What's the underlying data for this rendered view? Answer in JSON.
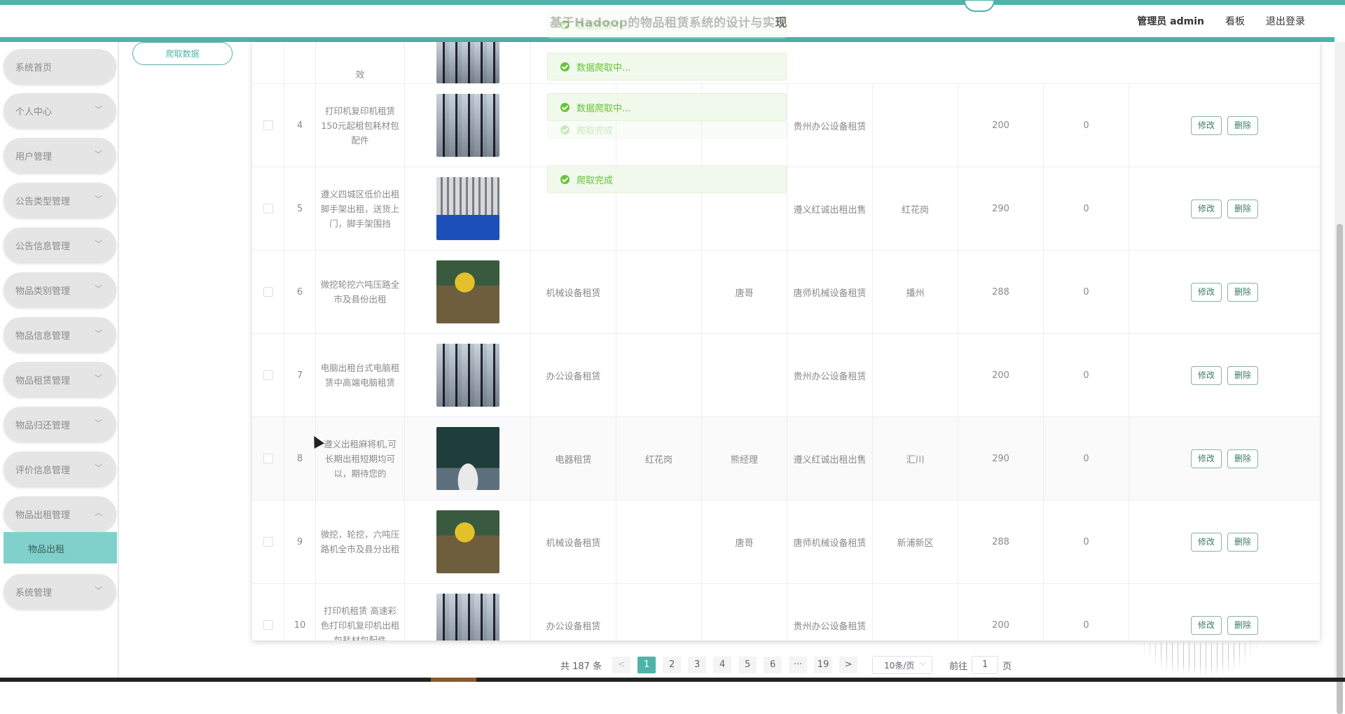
{
  "header": {
    "title_faded": "基于Hadoop的物品租赁系统的设计与实",
    "title_tail": "现",
    "user": "管理员 admin",
    "board": "看板",
    "logout": "退出登录"
  },
  "sidebar": {
    "items": [
      {
        "label": "系统首页",
        "chevron": ""
      },
      {
        "label": "个人中心",
        "chevron": "﹀"
      },
      {
        "label": "用户管理",
        "chevron": "﹀"
      },
      {
        "label": "公告类型管理",
        "chevron": "﹀"
      },
      {
        "label": "公告信息管理",
        "chevron": "﹀"
      },
      {
        "label": "物品类别管理",
        "chevron": "﹀"
      },
      {
        "label": "物品信息管理",
        "chevron": "﹀"
      },
      {
        "label": "物品租赁管理",
        "chevron": "﹀"
      },
      {
        "label": "物品归还管理",
        "chevron": "﹀"
      },
      {
        "label": "评价信息管理",
        "chevron": "﹀"
      },
      {
        "label": "物品出租管理",
        "chevron": "︿"
      }
    ],
    "submenu_label": "物品出租",
    "last_item": {
      "label": "系统管理",
      "chevron": "﹀"
    }
  },
  "crawl_button": "爬取数据",
  "top_row_partial_text": "效",
  "rows": [
    {
      "index": "4",
      "name": "打印机复印机租赁150元起租包耗材包配件",
      "image": "office-printer-image",
      "category": "",
      "area": "",
      "contact": "",
      "shop": "贵州办公设备租赁",
      "district": "",
      "price": "200",
      "count": "0"
    },
    {
      "index": "5",
      "name": "遵义四城区低价出租脚手架出租，送货上门，脚手架围挡",
      "image": "scaffold-image",
      "category": "",
      "area": "",
      "contact": "",
      "shop": "遵义红诚出租出售",
      "district": "红花岗",
      "price": "290",
      "count": "0"
    },
    {
      "index": "6",
      "name": "微挖轮挖六吨压路全市及县份出租",
      "image": "excavator-image",
      "category": "机械设备租赁",
      "area": "",
      "contact": "唐哥",
      "shop": "唐师机械设备租赁",
      "district": "播州",
      "price": "288",
      "count": "0"
    },
    {
      "index": "7",
      "name": "电脑出租台式电脑租赁中高端电脑租赁",
      "image": "office-printer-image",
      "category": "办公设备租赁",
      "area": "",
      "contact": "",
      "shop": "贵州办公设备租赁",
      "district": "",
      "price": "200",
      "count": "0"
    },
    {
      "index": "8",
      "name": "遵义出租麻将机,可长期出租短期均可以，期待您的",
      "image": "mahjong-table-image",
      "category": "电器租赁",
      "area": "红花岗",
      "contact": "熊经理",
      "shop": "遵义红诚出租出售",
      "district": "汇川",
      "price": "290",
      "count": "0"
    },
    {
      "index": "9",
      "name": "微挖，轮挖，六吨压路机全市及县分出租",
      "image": "excavator-image",
      "category": "机械设备租赁",
      "area": "",
      "contact": "唐哥",
      "shop": "唐师机械设备租赁",
      "district": "新浦新区",
      "price": "288",
      "count": "0"
    },
    {
      "index": "10",
      "name": "打印机租赁 高速彩色打印机复印机出租 包耗材包配件",
      "image": "office-printer-image",
      "category": "办公设备租赁",
      "area": "",
      "contact": "",
      "shop": "贵州办公设备租赁",
      "district": "",
      "price": "200",
      "count": "0"
    }
  ],
  "row_actions": {
    "edit": "修改",
    "delete": "删除"
  },
  "toasts": [
    {
      "text": "数据爬取中...",
      "faded": true
    },
    {
      "text": "数据爬取中...",
      "faded": false
    },
    {
      "text": "数据爬取中...",
      "faded": false
    },
    {
      "text": "爬取完成",
      "faded": true
    },
    {
      "text": "爬取完成",
      "faded": false
    }
  ],
  "pagination": {
    "total": "共 187 条",
    "prev": "<",
    "pages": [
      "1",
      "2",
      "3",
      "4",
      "5",
      "6",
      "···",
      "19"
    ],
    "current": "1",
    "next": ">",
    "page_size": "10条/页",
    "goto_prefix": "前往",
    "goto_value": "1",
    "goto_suffix": "页"
  },
  "colors": {
    "accent": "#4fb3a9",
    "sidebar_item": "#e5e5e5",
    "submenu_active": "#80d1cc",
    "toast_success": "#67c23a"
  }
}
